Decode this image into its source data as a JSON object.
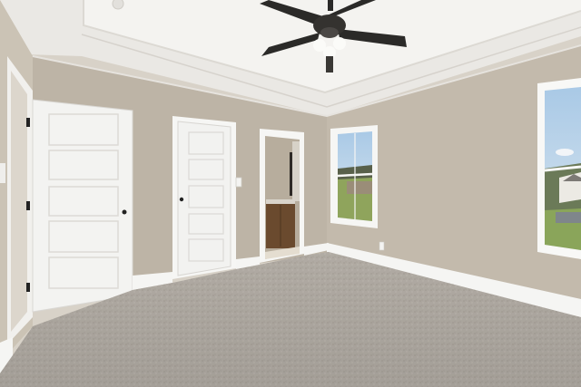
{
  "scene": {
    "colors": {
      "wall": "#bfb6a8",
      "wall_left": "#c9c0b2",
      "ceiling": "#eeedea",
      "tray_ceiling": "#f3f2ef",
      "trim": "#f7f7f5",
      "door": "#f3f3f1",
      "carpet": "#b9b3ab",
      "fan": "#2b2a28",
      "sky": "#b8d3ea",
      "grass": "#8aa55a",
      "vanity": "#6a4a2e"
    },
    "objects": [
      {
        "name": "ceiling-fan",
        "type": "fixture"
      },
      {
        "name": "left-closet-door",
        "type": "door"
      },
      {
        "name": "center-door",
        "type": "door"
      },
      {
        "name": "bathroom-doorway",
        "type": "opening"
      },
      {
        "name": "center-window",
        "type": "window"
      },
      {
        "name": "right-window",
        "type": "window"
      },
      {
        "name": "carpet-floor",
        "type": "floor"
      }
    ]
  }
}
